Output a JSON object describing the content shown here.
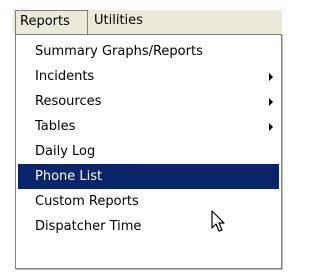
{
  "menubar": {
    "items": [
      {
        "label": "Reports"
      },
      {
        "label": "Utilities"
      }
    ]
  },
  "reports_menu": {
    "items": [
      {
        "label": "Summary Graphs/Reports",
        "has_submenu": false
      },
      {
        "label": "Incidents",
        "has_submenu": true
      },
      {
        "label": "Resources",
        "has_submenu": true
      },
      {
        "label": "Tables",
        "has_submenu": true
      },
      {
        "label": "Daily Log",
        "has_submenu": false
      },
      {
        "label": "Phone List",
        "has_submenu": false,
        "selected": true
      },
      {
        "label": "Custom Reports",
        "has_submenu": false
      },
      {
        "label": "Dispatcher Time",
        "has_submenu": false
      }
    ]
  },
  "colors": {
    "highlight": "#0a246a",
    "menubar_bg": "#ece9d8"
  },
  "cursor": {
    "icon": "arrow-cursor-icon"
  }
}
